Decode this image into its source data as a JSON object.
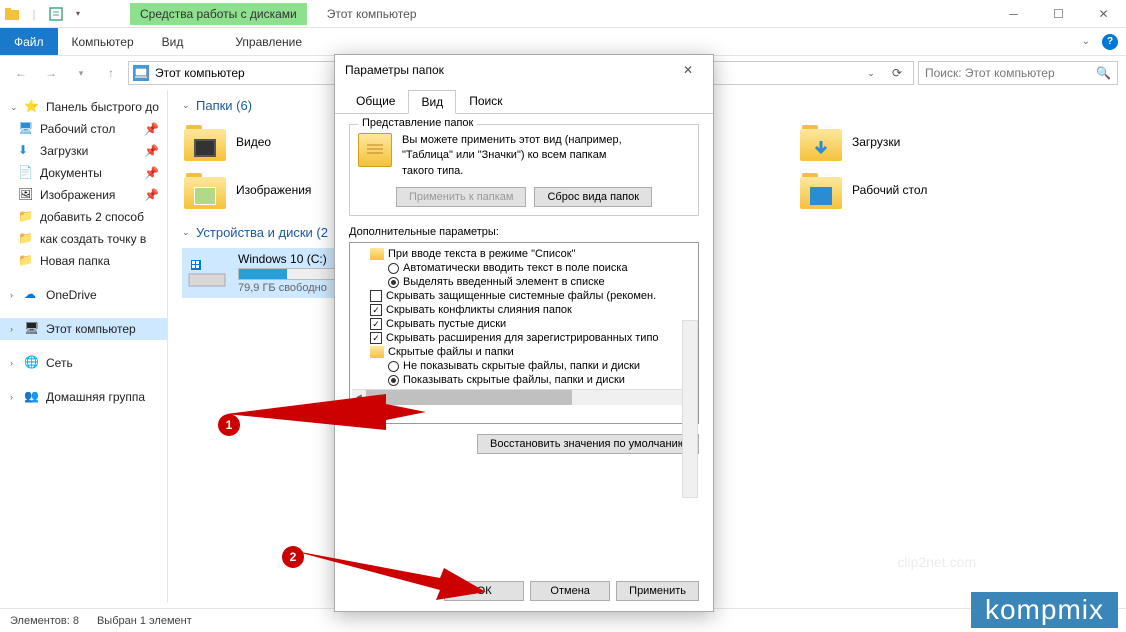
{
  "titlebar": {
    "contextual": "Средства работы с дисками",
    "title": "Этот компьютер"
  },
  "ribbon": {
    "file": "Файл",
    "computer": "Компьютер",
    "view": "Вид",
    "manage": "Управление"
  },
  "address": {
    "path": "Этот компьютер",
    "search_placeholder": "Поиск: Этот компьютер"
  },
  "sidebar": {
    "quick": "Панель быстрого до",
    "desktop": "Рабочий стол",
    "downloads": "Загрузки",
    "documents": "Документы",
    "pictures": "Изображения",
    "custom1": "добавить 2 способ",
    "custom2": "как создать точку в",
    "custom3": "Новая папка",
    "onedrive": "OneDrive",
    "thispc": "Этот компьютер",
    "network": "Сеть",
    "homegroup": "Домашняя группа"
  },
  "content": {
    "folders_header": "Папки (6)",
    "drives_header": "Устройства и диски (2",
    "videos": "Видео",
    "downloads": "Загрузки",
    "pictures": "Изображения",
    "desktop": "Рабочий стол",
    "drive_name": "Windows 10 (C:)",
    "drive_free": "79,9 ГБ свободно"
  },
  "statusbar": {
    "elements": "Элементов: 8",
    "selected": "Выбран 1 элемент"
  },
  "dialog": {
    "title": "Параметры папок",
    "tabs": {
      "general": "Общие",
      "view": "Вид",
      "search": "Поиск"
    },
    "groupbox_title": "Представление папок",
    "groupbox_text1": "Вы можете применить этот вид (например,",
    "groupbox_text2": "\"Таблица\" или \"Значки\") ко всем папкам",
    "groupbox_text3": "такого типа.",
    "apply_folders": "Применить к папкам",
    "reset_folders": "Сброс вида папок",
    "advanced_label": "Дополнительные параметры:",
    "tree": {
      "t1": "При вводе текста в режиме \"Список\"",
      "t2": "Автоматически вводить текст в поле поиска",
      "t3": "Выделять введенный элемент в списке",
      "t4": "Скрывать защищенные системные файлы (рекомен.",
      "t5": "Скрывать конфликты слияния папок",
      "t6": "Скрывать пустые диски",
      "t7": "Скрывать расширения для зарегистрированных типо",
      "t8": "Скрытые файлы и папки",
      "t9": "Не показывать скрытые файлы, папки и диски",
      "t10": "Показывать скрытые файлы, папки и диски"
    },
    "restore": "Восстановить значения по умолчанию",
    "ok": "ОК",
    "cancel": "Отмена",
    "apply": "Применить"
  },
  "annotations": {
    "num1": "1",
    "num2": "2"
  },
  "watermark": "kompmix"
}
